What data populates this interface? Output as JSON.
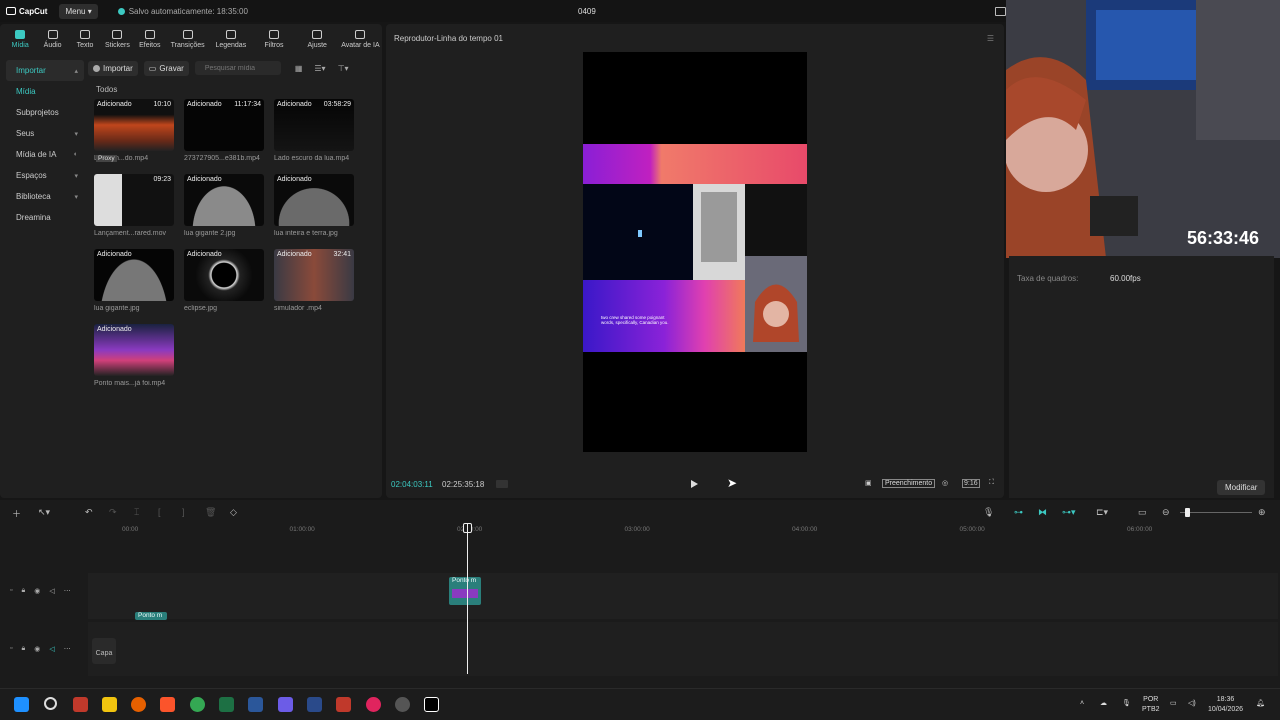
{
  "titlebar": {
    "app_name": "CapCut",
    "menu_label": "Menu",
    "autosave": "Salvo automaticamente: 18:35:00",
    "project_name": "0409"
  },
  "tools": [
    {
      "label": "Mídia",
      "icon": "media-icon",
      "active": true
    },
    {
      "label": "Áudio",
      "icon": "audio-icon"
    },
    {
      "label": "Texto",
      "icon": "text-icon"
    },
    {
      "label": "Stickers",
      "icon": "sticker-icon"
    },
    {
      "label": "Efeitos",
      "icon": "effects-icon"
    },
    {
      "label": "Transições",
      "icon": "transitions-icon"
    },
    {
      "label": "Legendas",
      "icon": "captions-icon"
    },
    {
      "label": "Filtros",
      "icon": "filters-icon"
    },
    {
      "label": "Ajuste",
      "icon": "adjust-icon"
    },
    {
      "label": "Avatar de IA",
      "icon": "ai-avatar-icon"
    }
  ],
  "sidebar": [
    {
      "label": "Importar",
      "chevron": "▴"
    },
    {
      "label": "Mídia"
    },
    {
      "label": "Subprojetos"
    },
    {
      "label": "Seus",
      "chevron": "▾"
    },
    {
      "label": "Mídia de IA",
      "chevron": "◐"
    },
    {
      "label": "Espaços",
      "chevron": "▾"
    },
    {
      "label": "Biblioteca",
      "chevron": "▾"
    },
    {
      "label": "Dreamina"
    }
  ],
  "media": {
    "import_label": "Importar",
    "record_label": "Gravar",
    "search_placeholder": "Pesquisar mídia",
    "section": "Todos",
    "items": [
      {
        "tag": "Adicionado",
        "duration": "10:10",
        "caption": "Lançam...do.mp4",
        "badge": "Proxy"
      },
      {
        "tag": "Adicionado",
        "duration": "11:17:34",
        "caption": "273727905...e381b.mp4"
      },
      {
        "tag": "Adicionado",
        "duration": "03:58:29",
        "caption": "Lado escuro da lua.mp4"
      },
      {
        "tag": "",
        "duration": "09:23",
        "caption": "Lançament...rared.mov"
      },
      {
        "tag": "Adicionado",
        "duration": "",
        "caption": "lua gigante 2.jpg"
      },
      {
        "tag": "Adicionado",
        "duration": "",
        "caption": "lua inteira e terra.jpg"
      },
      {
        "tag": "Adicionado",
        "duration": "",
        "caption": "lua gigante.jpg"
      },
      {
        "tag": "Adicionado",
        "duration": "",
        "caption": "eclipse.jpg"
      },
      {
        "tag": "Adicionado",
        "duration": "32:41",
        "caption": "simulador .mp4"
      },
      {
        "tag": "Adicionado",
        "duration": "",
        "caption": "Ponto mais...já foi.mp4"
      }
    ]
  },
  "player": {
    "title": "Reprodutor-Linha do tempo 01",
    "current_time": "02:04:03:11",
    "total_time": "02:25:35:18",
    "fill_label": "Preenchimento",
    "ratio_label": "9:16",
    "caption_text": "two crew shared some poignant words, specifically, Canadian you."
  },
  "webcam": {
    "clock": "56:33:46"
  },
  "properties": {
    "frame_rate_label": "Taxa de quadros:",
    "frame_rate_value": "60.00fps",
    "modify_label": "Modificar"
  },
  "timeline": {
    "ticks": [
      "00:00",
      "01:00:00",
      "02:00:00",
      "03:00:00",
      "04:00:00",
      "05:00:00",
      "06:00:00"
    ],
    "clip_label": "Ponto m",
    "clip2_label": "Ponto m",
    "cover_label": "Capa"
  },
  "taskbar": {
    "lang": "POR",
    "lang_sub": "PTB2",
    "time": "18:36",
    "date": "10/04/2026"
  }
}
